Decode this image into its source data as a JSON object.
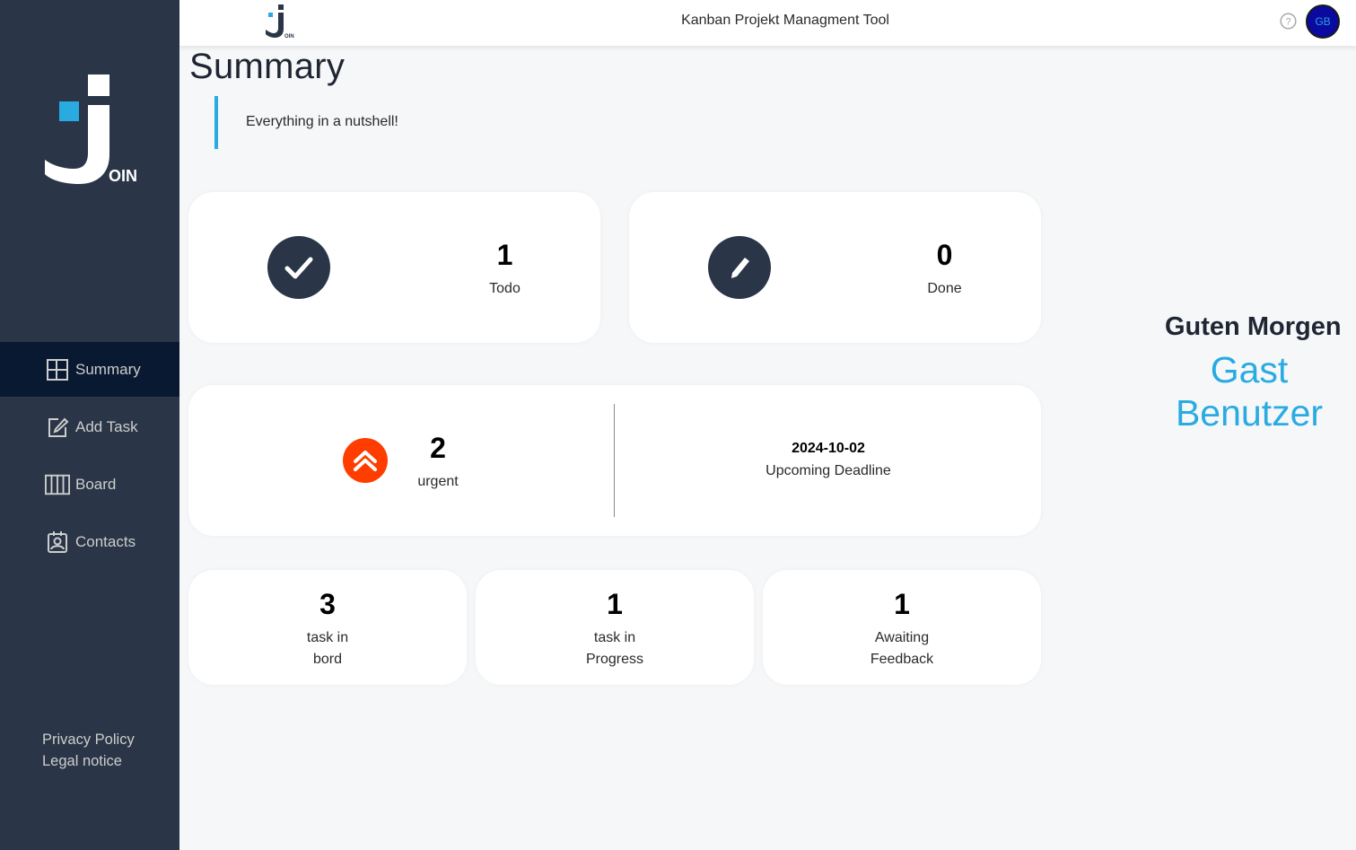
{
  "header": {
    "title": "Kanban Projekt Managment Tool",
    "avatar_initials": "GB",
    "help_icon": "question-circle-icon"
  },
  "logo": {
    "letter_suffix": "OIN",
    "small_suffix": "OIN"
  },
  "sidebar": {
    "items": [
      {
        "label": "Summary",
        "icon": "summary-icon",
        "active": true
      },
      {
        "label": "Add Task",
        "icon": "edit-square-icon",
        "active": false
      },
      {
        "label": "Board",
        "icon": "board-icon",
        "active": false
      },
      {
        "label": "Contacts",
        "icon": "contacts-icon",
        "active": false
      }
    ],
    "footer": {
      "privacy": "Privacy Policy",
      "legal": "Legal notice"
    }
  },
  "main": {
    "title": "Summary",
    "tagline": "Everything in a nutshell!",
    "todo": {
      "value": "1",
      "label": "Todo"
    },
    "done": {
      "value": "0",
      "label": "Done"
    },
    "urgent": {
      "value": "2",
      "label": "urgent"
    },
    "deadline": {
      "date": "2024-10-02",
      "label": "Upcoming Deadline"
    },
    "stats": [
      {
        "value": "3",
        "line1": "task in",
        "line2": "bord"
      },
      {
        "value": "1",
        "line1": "task in",
        "line2": "Progress"
      },
      {
        "value": "1",
        "line1": "Awaiting",
        "line2": "Feedback"
      }
    ]
  },
  "greeting": {
    "text": "Guten Morgen",
    "name_line1": "Gast",
    "name_line2": "Benutzer"
  },
  "colors": {
    "sidebar": "#2a3647",
    "sidebar_active": "#091931",
    "accent": "#29abe2",
    "urgent": "#ff3d00",
    "page_bg": "#f6f7f8"
  }
}
